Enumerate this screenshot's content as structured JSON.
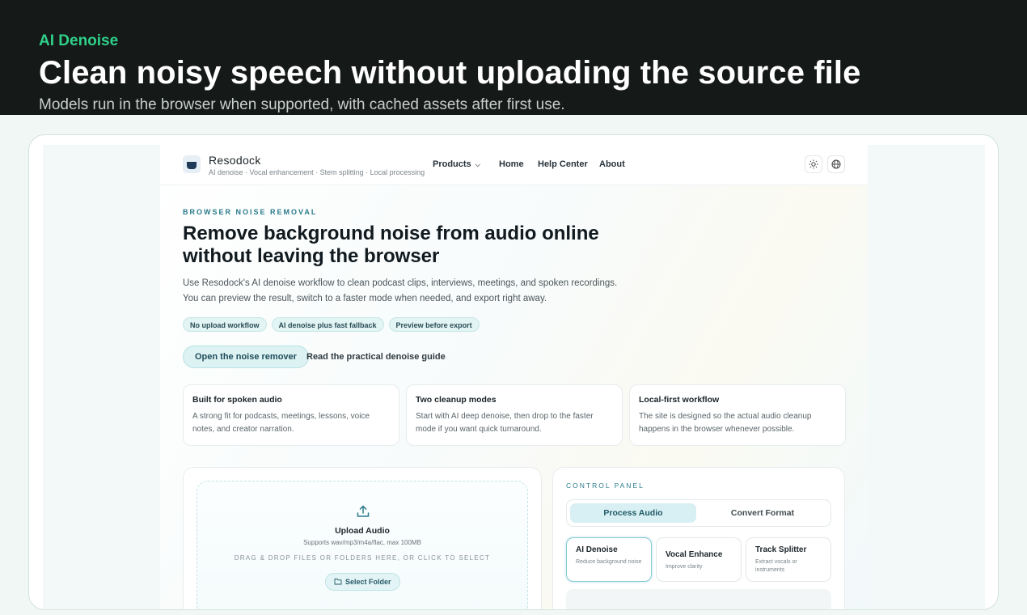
{
  "page": {
    "eyebrow": "AI Denoise",
    "title": "Clean noisy speech without uploading the source file",
    "subtitle": "Models run in the browser when supported, with cached assets after first use."
  },
  "nav": {
    "brand": "Resodock",
    "tagline": "AI denoise · Vocal enhancement · Stem splitting · Local processing",
    "links": [
      "Products",
      "Home",
      "Help Center",
      "About"
    ],
    "icons": [
      "sun-icon",
      "globe-icon"
    ]
  },
  "hero": {
    "kicker": "BROWSER NOISE REMOVAL",
    "title": "Remove background noise from audio online without leaving the browser",
    "description": "Use Resodock's AI denoise workflow to clean podcast clips, interviews, meetings, and spoken recordings. You can preview the result, switch to a faster mode when needed, and export right away.",
    "chips": [
      "No upload workflow",
      "AI denoise plus fast fallback",
      "Preview before export"
    ],
    "cta": "Open the noise remover",
    "guide_link": "Read the practical denoise guide"
  },
  "features": [
    {
      "title": "Built for spoken audio",
      "text": "A strong fit for podcasts, meetings, lessons, voice notes, and creator narration."
    },
    {
      "title": "Two cleanup modes",
      "text": "Start with AI deep denoise, then drop to the faster mode if you want quick turnaround."
    },
    {
      "title": "Local-first workflow",
      "text": "The site is designed so the actual audio cleanup happens in the browser whenever possible."
    }
  ],
  "upload": {
    "title": "Upload Audio",
    "formats": "Supports wav/mp3/m4a/flac, max 100MB",
    "hint": "DRAG & DROP FILES OR FOLDERS HERE, OR CLICK TO SELECT",
    "button": "Select Folder"
  },
  "control": {
    "label": "CONTROL PANEL",
    "tabs": [
      "Process Audio",
      "Convert Format"
    ],
    "modes": [
      {
        "title": "AI Denoise",
        "text": "Reduce background noise"
      },
      {
        "title": "Vocal Enhance",
        "text": "Improve clarity"
      },
      {
        "title": "Track Splitter",
        "text": "Extract vocals or instruments"
      }
    ]
  },
  "colors": {
    "accent": "#2fd08a",
    "teal": "#2a7a8a",
    "header_bg": "#151917"
  }
}
